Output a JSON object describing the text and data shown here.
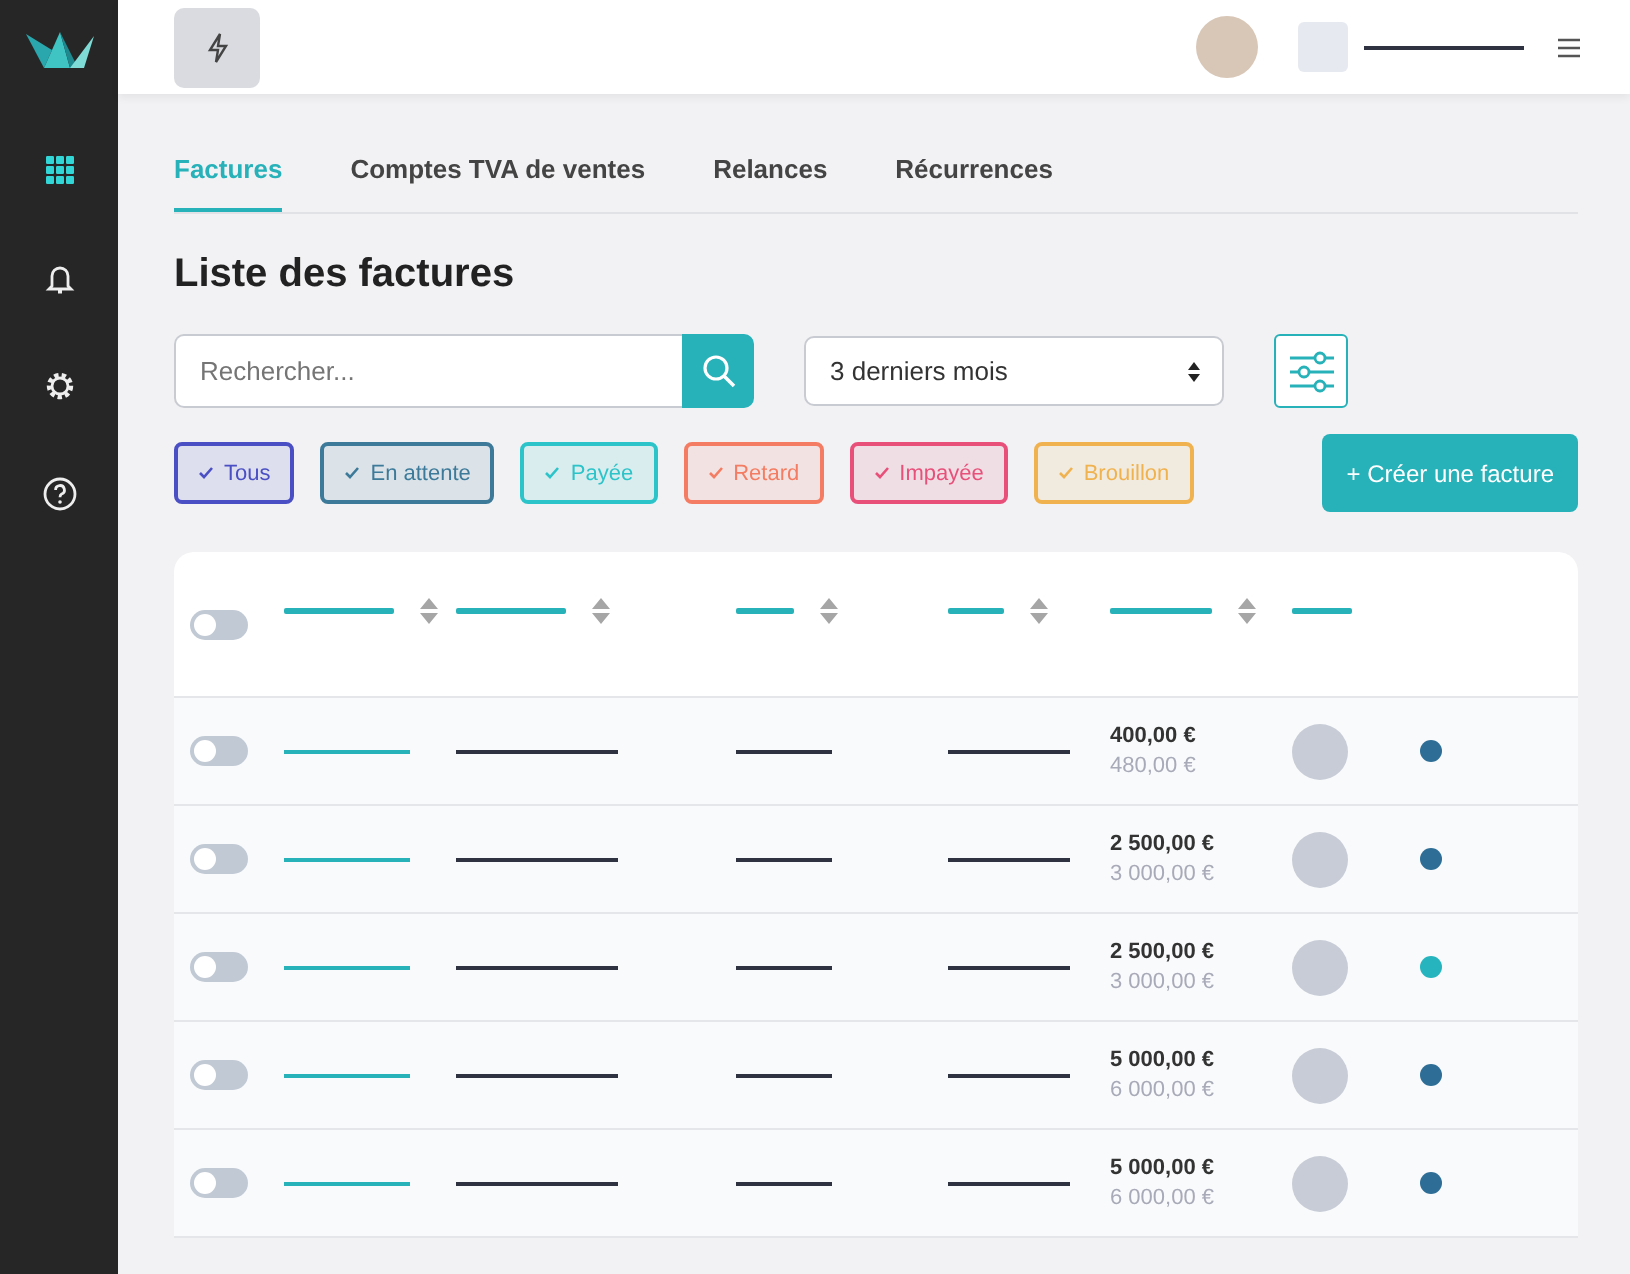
{
  "sidebar": {
    "items": [
      {
        "kind": "grid",
        "selected": true
      },
      {
        "kind": "bell",
        "selected": false
      },
      {
        "kind": "gear",
        "selected": false
      },
      {
        "kind": "help",
        "selected": false
      }
    ]
  },
  "tabs": [
    {
      "label": "Factures",
      "selected": true
    },
    {
      "label": "Comptes TVA de ventes",
      "selected": false
    },
    {
      "label": "Relances",
      "selected": false
    },
    {
      "label": "Récurrences",
      "selected": false
    }
  ],
  "title": "Liste des factures",
  "search": {
    "placeholder": "Rechercher..."
  },
  "period": {
    "value": "3 derniers mois"
  },
  "filters": [
    {
      "label": "Tous",
      "checked": true,
      "color": "#4a4fc4"
    },
    {
      "label": "En attente",
      "checked": true,
      "color": "#3d7a99"
    },
    {
      "label": "Payée",
      "checked": true,
      "color": "#2cc4c9"
    },
    {
      "label": "Retard",
      "checked": true,
      "color": "#f47c62"
    },
    {
      "label": "Impayée",
      "checked": true,
      "color": "#e8507a"
    },
    {
      "label": "Brouillon",
      "checked": true,
      "color": "#f0b24e"
    }
  ],
  "create_button": "+ Créer une facture",
  "table": {
    "header": {
      "on": false,
      "columns": [
        {
          "sortable": true
        },
        {
          "sortable": true
        },
        {
          "sortable": true
        },
        {
          "sortable": true
        },
        {
          "sortable": true
        },
        {
          "sortable": false
        }
      ]
    },
    "rows": [
      {
        "on": false,
        "amount": "400,00 €",
        "amount_ttc": "480,00 €",
        "color": "#2e6e96"
      },
      {
        "on": false,
        "amount": "2 500,00 €",
        "amount_ttc": "3 000,00 €",
        "color": "#2e6e96"
      },
      {
        "on": false,
        "amount": "2 500,00 €",
        "amount_ttc": "3 000,00 €",
        "color": "#26b5be"
      },
      {
        "on": false,
        "amount": "5 000,00 €",
        "amount_ttc": "6 000,00 €",
        "color": "#2e6e96"
      },
      {
        "on": false,
        "amount": "5 000,00 €",
        "amount_ttc": "6 000,00 €",
        "color": "#2e6e96"
      }
    ]
  }
}
